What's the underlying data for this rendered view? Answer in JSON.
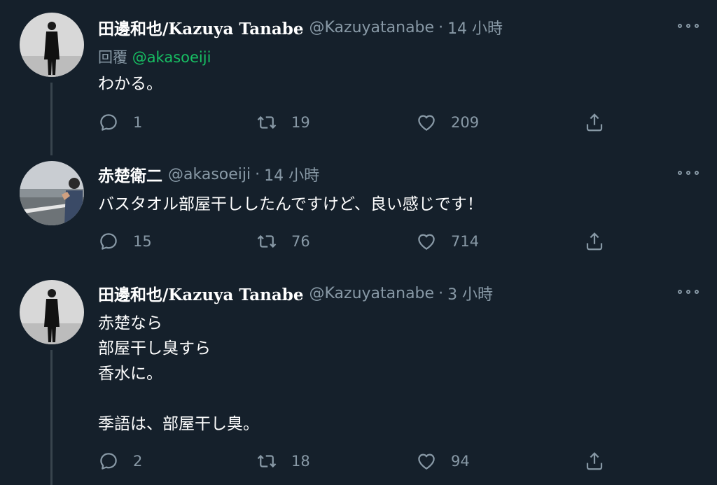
{
  "tweets": [
    {
      "author_name": "田邊和也/Kazuya Tanabe",
      "handle": "@Kazuyatanabe",
      "separator": "·",
      "time": "14 小時",
      "reply_prefix": "回覆",
      "reply_mention": "@akasoeiji",
      "text": "わかる。",
      "reply_count": "1",
      "retweet_count": "19",
      "like_count": "209"
    },
    {
      "author_name": "赤楚衛二",
      "handle": "@akasoeiji",
      "separator": "·",
      "time": "14 小時",
      "text": "バスタオル部屋干ししたんですけど、良い感じです！",
      "reply_count": "15",
      "retweet_count": "76",
      "like_count": "714"
    },
    {
      "author_name": "田邊和也/Kazuya Tanabe",
      "handle": "@Kazuyatanabe",
      "separator": "·",
      "time": "3 小時",
      "text": "赤楚なら\n部屋干し臭すら\n香水に。\n\n季語は、部屋干し臭。",
      "reply_count": "2",
      "retweet_count": "18",
      "like_count": "94"
    }
  ],
  "colors": {
    "background": "#15202b",
    "secondary_text": "#8899a6",
    "mention": "#17bf63",
    "thread_line": "#38444d"
  },
  "icons": [
    "reply-icon",
    "retweet-icon",
    "like-icon",
    "share-icon",
    "more-icon"
  ]
}
